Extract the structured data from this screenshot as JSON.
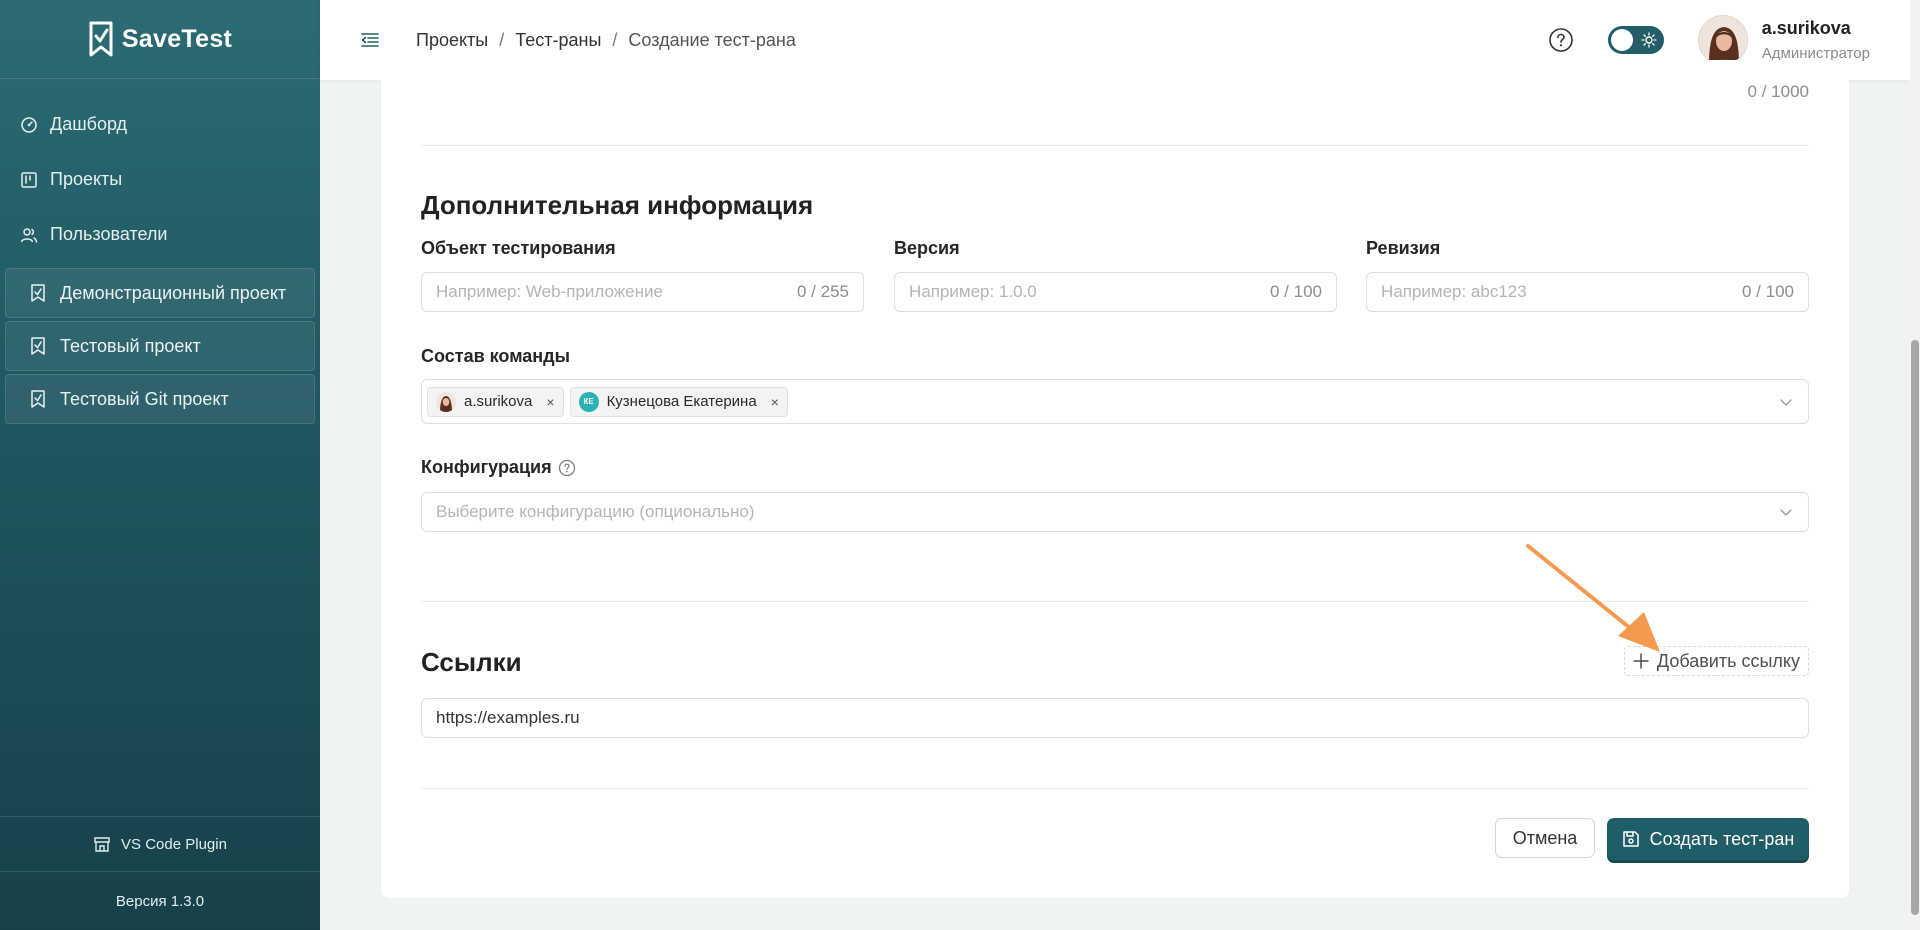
{
  "sidebar": {
    "logo": "SaveTest",
    "nav": [
      {
        "label": "Дашборд",
        "icon": "dashboard-icon"
      },
      {
        "label": "Проекты",
        "icon": "board-icon"
      },
      {
        "label": "Пользователи",
        "icon": "users-icon"
      }
    ],
    "projects": [
      {
        "label": "Демонстрационный проект",
        "icon": "checklist-icon"
      },
      {
        "label": "Тестовый проект",
        "icon": "checklist-icon"
      },
      {
        "label": "Тестовый Git проект",
        "icon": "checklist-icon"
      }
    ],
    "plugin_label": "VS Code Plugin",
    "version": "Версия 1.3.0"
  },
  "header": {
    "breadcrumb": [
      "Проекты",
      "Тест-раны",
      "Создание тест-рана"
    ],
    "separator": "/",
    "user_name": "a.surikova",
    "user_role": "Администратор"
  },
  "form": {
    "top_counter": "0 / 1000",
    "additional_title": "Дополнительная информация",
    "object_label": "Объект тестирования",
    "object_placeholder": "Например: Web-приложение",
    "object_counter": "0 / 255",
    "version_label": "Версия",
    "version_placeholder": "Например: 1.0.0",
    "version_counter": "0 / 100",
    "revision_label": "Ревизия",
    "revision_placeholder": "Например: abc123",
    "revision_counter": "0 / 100",
    "team_label": "Состав команды",
    "team": [
      {
        "name": "a.surikova",
        "avatar": "photo"
      },
      {
        "name": "Кузнецова Екатерина",
        "avatar": "initials",
        "initials": "КЕ"
      }
    ],
    "tag_remove": "×",
    "config_label": "Конфигурация",
    "config_placeholder": "Выберите конфигурацию (опционально)",
    "links_title": "Ссылки",
    "add_link_label": "Добавить ссылку",
    "link_value": "https://examples.ru",
    "cancel_label": "Отмена",
    "create_label": "Создать тест-ран"
  },
  "colors": {
    "primary": "#1f5e69",
    "sidebar_top": "#2c6b74",
    "sidebar_bottom": "#174149",
    "annotation_arrow": "#f39a4e"
  }
}
